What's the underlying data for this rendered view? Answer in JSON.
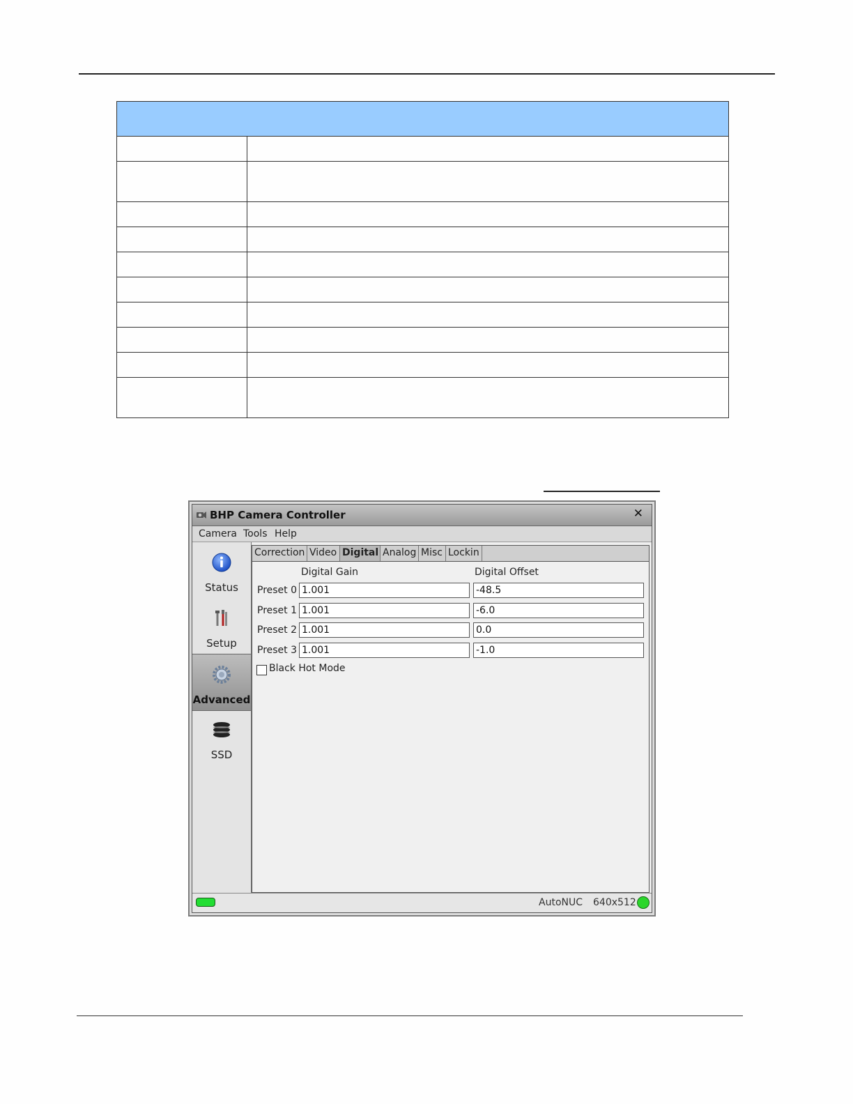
{
  "window": {
    "title": "BHP Camera Controller",
    "close_glyph": "✕",
    "menu": [
      "Camera",
      "Tools",
      "Help"
    ]
  },
  "sidebar": {
    "items": [
      {
        "label": "Status",
        "icon": "info-icon"
      },
      {
        "label": "Setup",
        "icon": "tools-icon"
      },
      {
        "label": "Advanced",
        "icon": "gear-icon",
        "active": true
      },
      {
        "label": "SSD",
        "icon": "disk-stack-icon"
      }
    ]
  },
  "tabs": [
    "Correction",
    "Video",
    "Digital",
    "Analog",
    "Misc",
    "Lockin"
  ],
  "active_tab": "Digital",
  "digital": {
    "gain_header": "Digital Gain",
    "offset_header": "Digital Offset",
    "presets": [
      {
        "label": "Preset 0",
        "gain": "1.001",
        "offset": "-48.5"
      },
      {
        "label": "Preset 1",
        "gain": "1.001",
        "offset": "-6.0"
      },
      {
        "label": "Preset 2",
        "gain": "1.001",
        "offset": "0.0"
      },
      {
        "label": "Preset 3",
        "gain": "1.001",
        "offset": "-1.0"
      }
    ],
    "black_hot_label": "Black Hot Mode",
    "black_hot_checked": false
  },
  "status": {
    "mode": "AutoNUC",
    "resolution": "640x512",
    "indicator_color": "#2bd62b"
  },
  "colors": {
    "table_header": "#99ccff"
  }
}
